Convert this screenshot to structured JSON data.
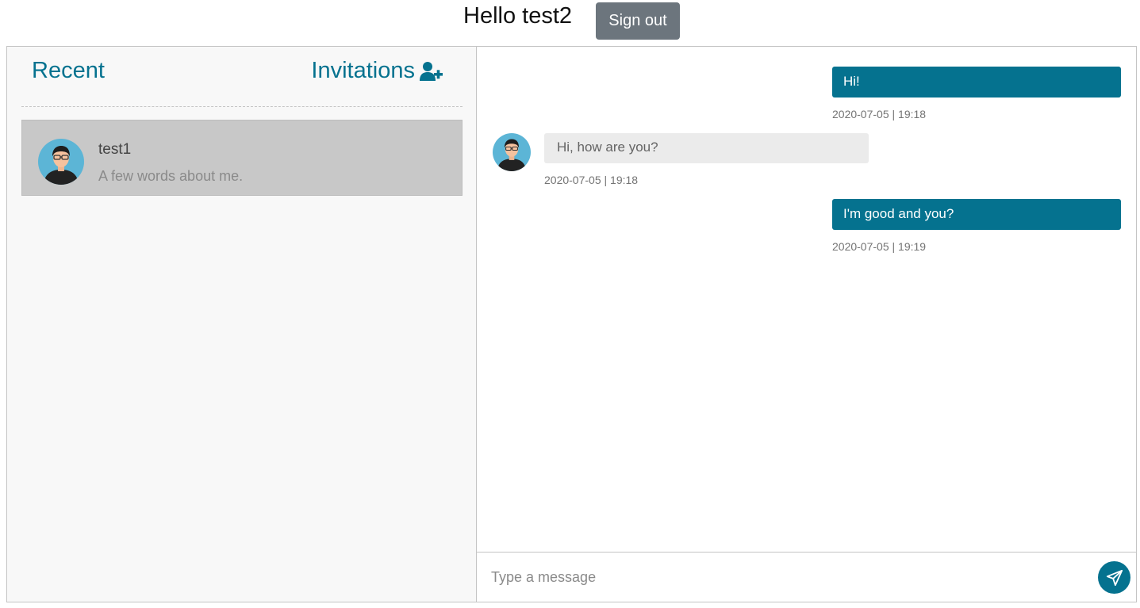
{
  "header": {
    "greeting": "Hello test2",
    "sign_out_label": "Sign out"
  },
  "inbox": {
    "recent_label": "Recent",
    "invitations_label": "Invitations",
    "chats": [
      {
        "name": "test1",
        "about": "A few words about me."
      }
    ]
  },
  "messages": [
    {
      "direction": "outgoing",
      "text": "Hi!",
      "time": "2020-07-05 | 19:18"
    },
    {
      "direction": "incoming",
      "text": "Hi, how are you?",
      "time": "2020-07-05 | 19:18"
    },
    {
      "direction": "outgoing",
      "text": "I'm good and you?",
      "time": "2020-07-05 | 19:19"
    }
  ],
  "composer": {
    "placeholder": "Type a message",
    "value": ""
  },
  "icons": {
    "invite": "user-plus-icon",
    "send": "paper-plane-icon",
    "avatar": "user-avatar-icon"
  },
  "colors": {
    "accent": "#05728f",
    "sign_out_bg": "#6c757d",
    "selected_chat_bg": "#c8c8c8",
    "incoming_bubble_bg": "#ebebeb",
    "inbox_bg": "#f8f8f8"
  }
}
